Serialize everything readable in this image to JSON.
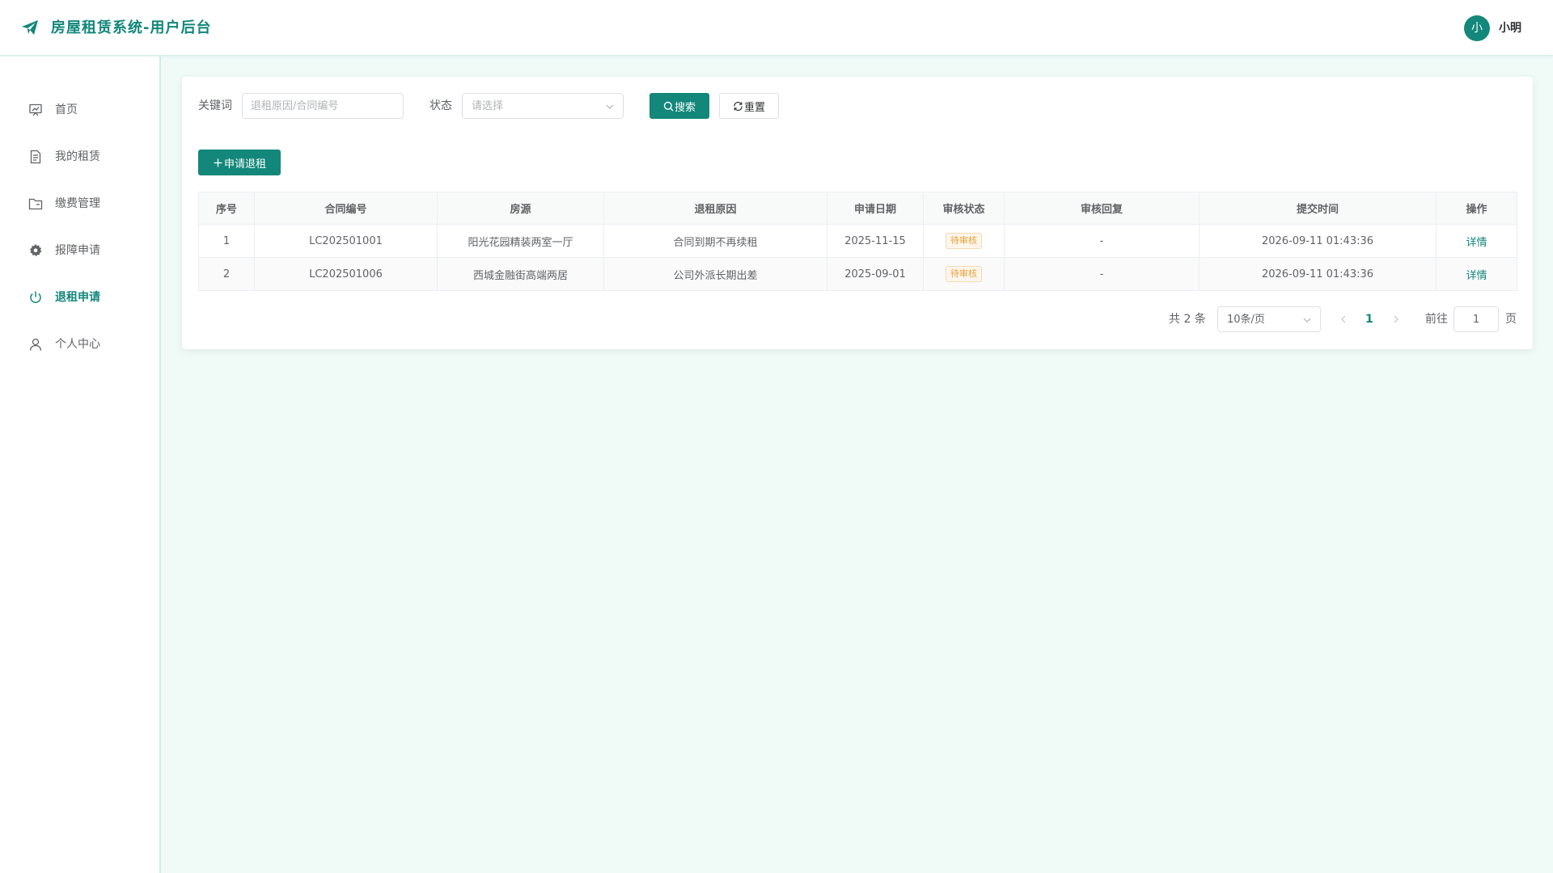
{
  "header": {
    "title": "房屋租赁系统-用户后台",
    "avatar_text": "小",
    "username": "小明"
  },
  "sidebar": {
    "items": [
      {
        "label": "首页",
        "icon": "monitor-icon",
        "active": false
      },
      {
        "label": "我的租赁",
        "icon": "document-icon",
        "active": false
      },
      {
        "label": "缴费管理",
        "icon": "folder-icon",
        "active": false
      },
      {
        "label": "报障申请",
        "icon": "gear-icon",
        "active": false
      },
      {
        "label": "退租申请",
        "icon": "power-icon",
        "active": true
      },
      {
        "label": "个人中心",
        "icon": "user-icon",
        "active": false
      }
    ]
  },
  "filters": {
    "keyword_label": "关键词",
    "keyword_placeholder": "退租原因/合同编号",
    "keyword_value": "",
    "status_label": "状态",
    "status_placeholder": "请选择",
    "search_label": "搜索",
    "reset_label": "重置"
  },
  "toolbar": {
    "apply_label": "申请退租"
  },
  "table": {
    "columns": [
      "序号",
      "合同编号",
      "房源",
      "退租原因",
      "申请日期",
      "审核状态",
      "审核回复",
      "提交时间",
      "操作"
    ],
    "rows": [
      {
        "index": "1",
        "contract": "LC202501001",
        "house": "阳光花园精装两室一厅",
        "reason": "合同到期不再续租",
        "apply_date": "2025-11-15",
        "status": "待审核",
        "reply": "-",
        "submit_time": "2026-09-11 01:43:36",
        "action": "详情"
      },
      {
        "index": "2",
        "contract": "LC202501006",
        "house": "西城金融街高端两居",
        "reason": "公司外派长期出差",
        "apply_date": "2025-09-01",
        "status": "待审核",
        "reply": "-",
        "submit_time": "2026-09-11 01:43:36",
        "action": "详情"
      }
    ]
  },
  "pagination": {
    "total_text": "共 2 条",
    "page_size": "10条/页",
    "current_page": "1",
    "goto_label": "前往",
    "goto_value": "1",
    "page_suffix": "页"
  },
  "colors": {
    "brand": "#12877a",
    "background": "#f0fbf8",
    "warning_tag": "#e6a23c"
  }
}
